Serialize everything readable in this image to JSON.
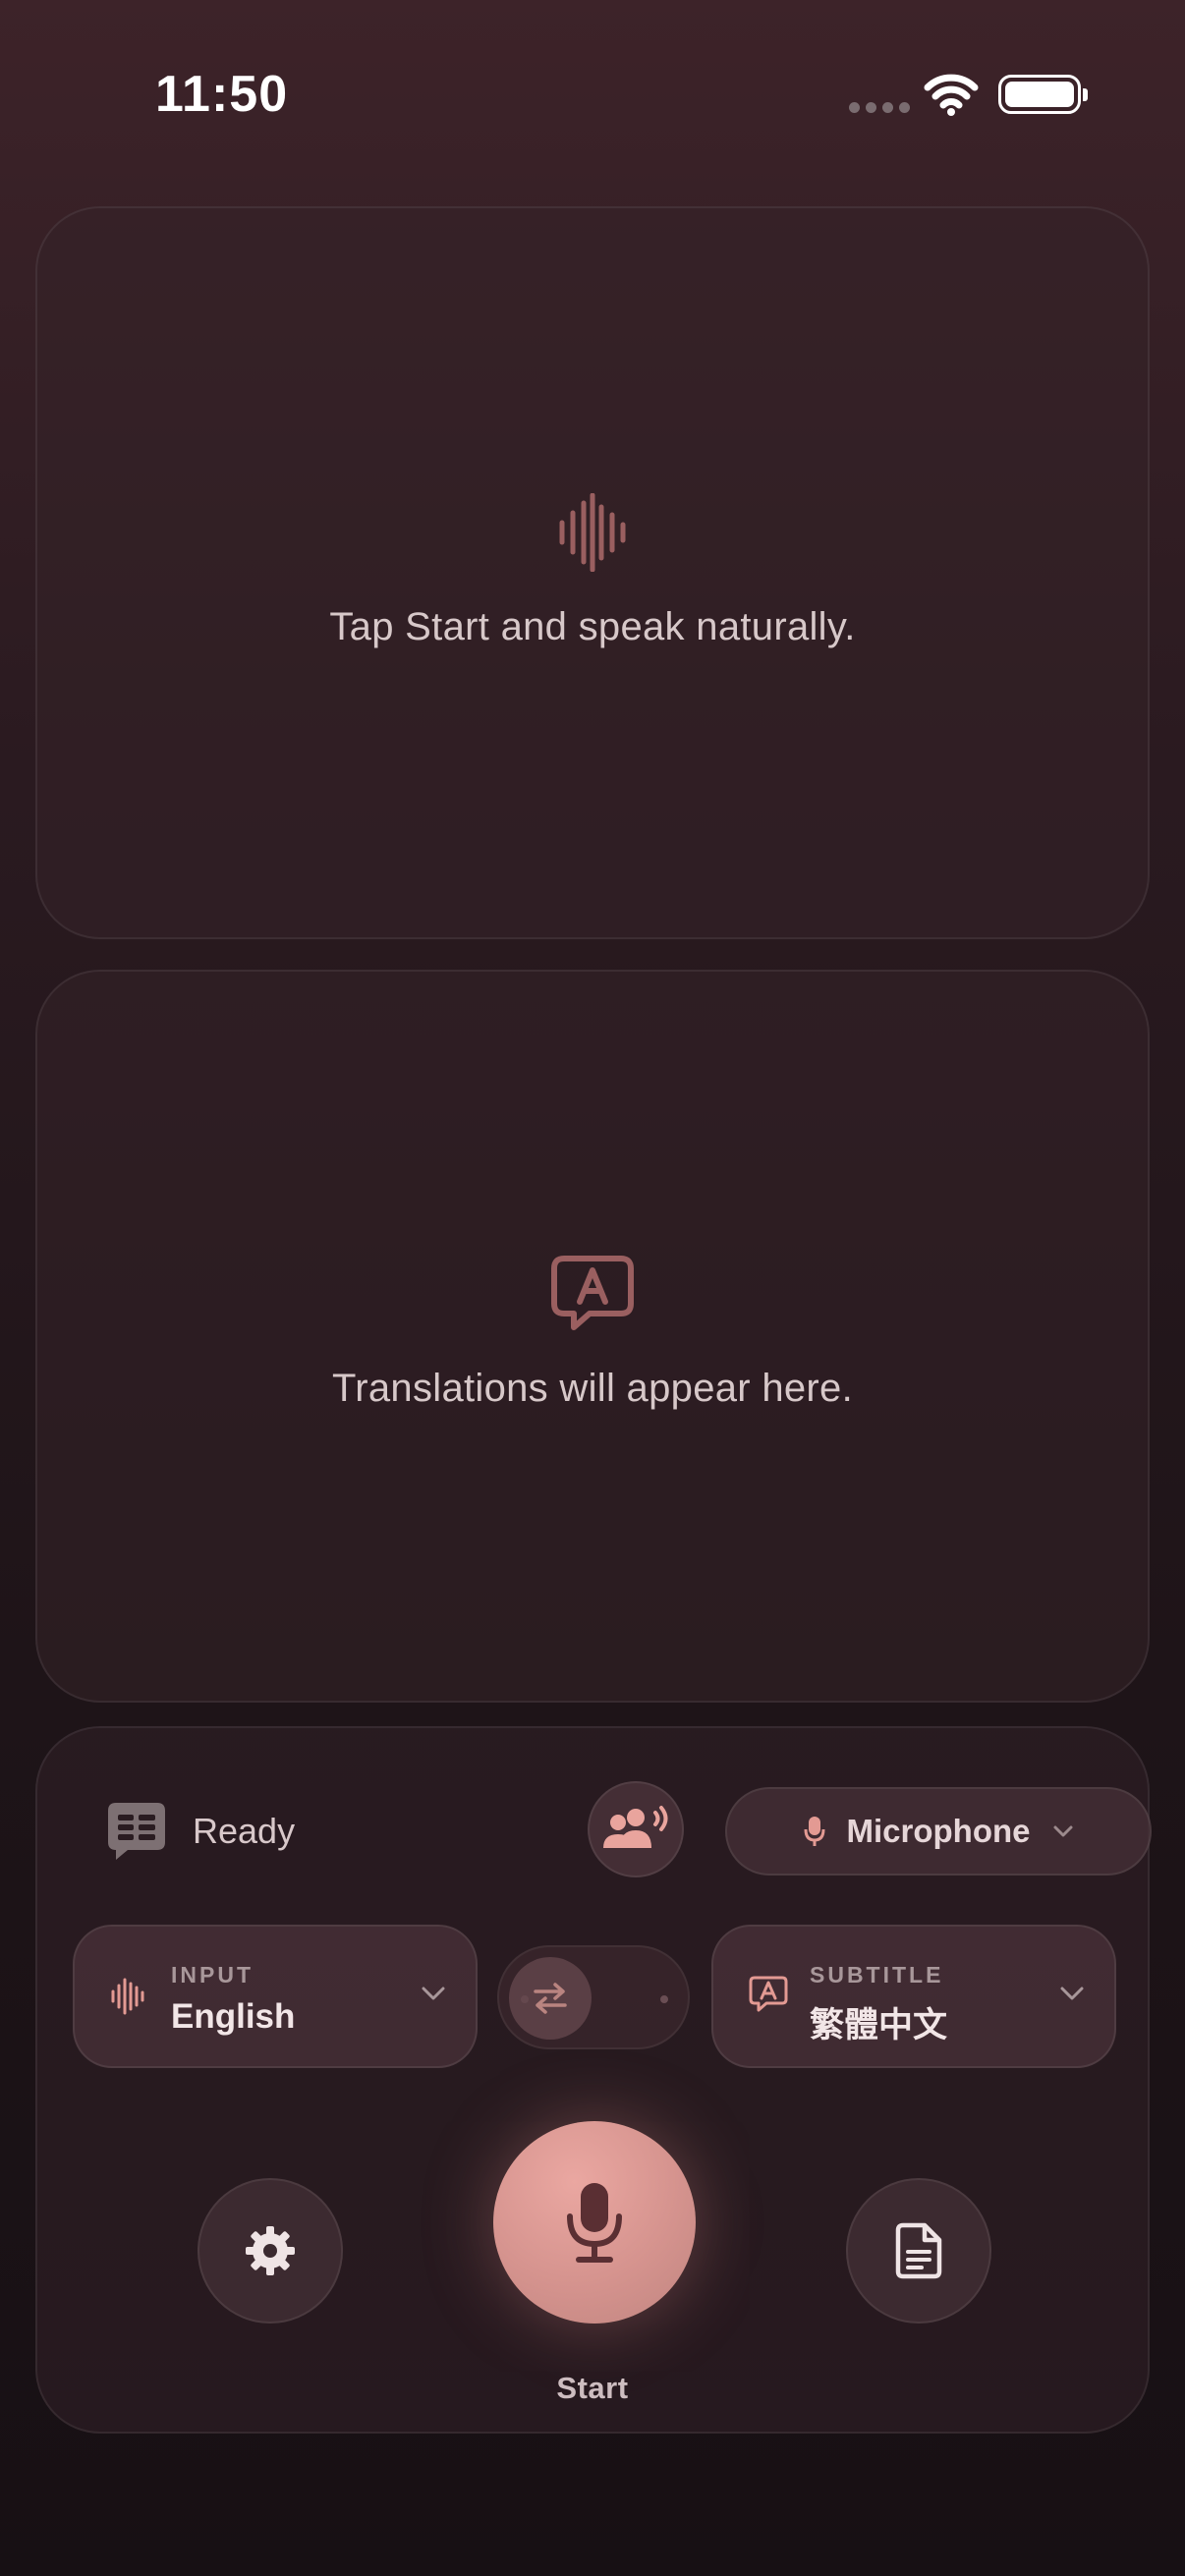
{
  "status_bar": {
    "time": "11:50"
  },
  "transcript": {
    "empty_text": "Tap Start and speak naturally."
  },
  "translation": {
    "empty_text": "Translations will appear here."
  },
  "controls": {
    "status_label": "Ready",
    "audio_source_label": "Microphone",
    "input_language": {
      "tag": "INPUT",
      "value": "English"
    },
    "subtitle_language": {
      "tag": "SUBTITLE",
      "value": "繁體中文"
    },
    "start_label": "Start"
  },
  "colors": {
    "accent": "#d5938e",
    "icon_muted": "#9a5f60"
  },
  "icons": {
    "status_bar": [
      "cellular-dots-icon",
      "wifi-icon",
      "battery-icon"
    ],
    "transcript": "waveform-icon",
    "translation": "translate-bubble-icon",
    "controls": [
      "captions-icon",
      "speaker-group-icon",
      "microphone-icon",
      "chevron-down-icon",
      "swap-arrows-icon",
      "gear-icon",
      "document-icon"
    ]
  }
}
